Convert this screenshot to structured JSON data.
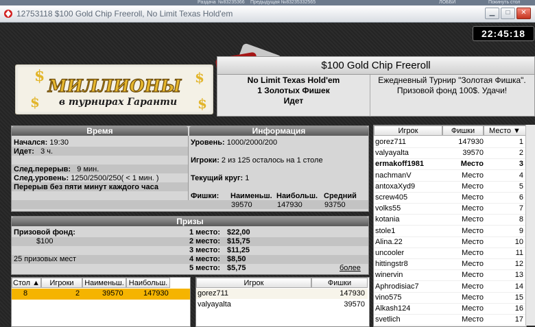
{
  "taskbar": {
    "items": [
      "Раздача",
      "№83235366",
      "Предыдущая №83235332565",
      "ЛОББИ",
      "Покинуть стол"
    ]
  },
  "window": {
    "title": "12753118 $100 Gold Chip Freeroll, No Limit Texas Hold'em",
    "clock": "22:45:18"
  },
  "logo": {
    "text": "МИЛЛИОНЫ",
    "subtext": "в турнирах Гаранти"
  },
  "tournament": {
    "name": "$100 Gold Chip Freeroll",
    "game": "No Limit Texas Hold'em",
    "chips_type": "1 Золотых Фишек",
    "status": "Идет",
    "description": "Ежедневный Турнир \"Золотая Фишка\". Призовой фонд 100$. Удачи!"
  },
  "time_panel": {
    "header_time": "Время",
    "header_info": "Информация",
    "started_label": "Начался:",
    "started_value": "19:30",
    "running_label": "Идет:",
    "running_value": "3 ч.",
    "next_break_label": "След.перерыв:",
    "next_break_value": "9 мин.",
    "next_level_label": "След.уровень:",
    "next_level_value": "1250/2500/250( < 1 мин. )",
    "break_note": "Перерыв без пяти минут каждого часа",
    "level_label": "Уровень:",
    "level_value": "1000/2000/200",
    "players_label": "Игроки:",
    "players_value": "2 из 125 осталось на 1 столе",
    "round_label": "Текущий круг:",
    "round_value": "1",
    "chips_label": "Фишки:",
    "chips_min_label": "Наименьш.",
    "chips_max_label": "Наибольш.",
    "chips_avg_label": "Средний",
    "chips_min": "39570",
    "chips_max": "147930",
    "chips_avg": "93750"
  },
  "prizes": {
    "header": "Призы",
    "pool_label": "Призовой фонд:",
    "pool_value": "$100",
    "paid_places": "25 призовых мест",
    "places": [
      {
        "label": "1 место:",
        "value": "$22,00"
      },
      {
        "label": "2 место:",
        "value": "$15,75"
      },
      {
        "label": "3 место:",
        "value": "$11,25"
      },
      {
        "label": "4 место:",
        "value": "$8,50"
      },
      {
        "label": "5 место:",
        "value": "$5,75"
      }
    ],
    "more_link": "более"
  },
  "tables": {
    "headers": [
      "Стол",
      "Игроки",
      "Наименьш.",
      "Наибольш."
    ],
    "rows": [
      {
        "table": "8",
        "players": "2",
        "min": "39570",
        "max": "147930"
      }
    ]
  },
  "table_players": {
    "headers": [
      "Игрок",
      "Фишки"
    ],
    "rows": [
      {
        "name": "gorez711",
        "chips": "147930"
      },
      {
        "name": "valyayalta",
        "chips": "39570"
      }
    ]
  },
  "standings": {
    "headers": [
      "Игрок",
      "Фишки",
      "Место"
    ],
    "rows": [
      {
        "name": "gorez711",
        "chips": "147930",
        "place": "1",
        "bold": false
      },
      {
        "name": "valyayalta",
        "chips": "39570",
        "place": "2",
        "bold": false
      },
      {
        "name": "ermakoff1981",
        "chips": "Место",
        "place": "3",
        "bold": true
      },
      {
        "name": "nachmanV",
        "chips": "Место",
        "place": "4",
        "bold": false
      },
      {
        "name": "antoxaXyd9",
        "chips": "Место",
        "place": "5",
        "bold": false
      },
      {
        "name": "screw405",
        "chips": "Место",
        "place": "6",
        "bold": false
      },
      {
        "name": "volks55",
        "chips": "Место",
        "place": "7",
        "bold": false
      },
      {
        "name": "kotania",
        "chips": "Место",
        "place": "8",
        "bold": false
      },
      {
        "name": "stole1",
        "chips": "Место",
        "place": "9",
        "bold": false
      },
      {
        "name": "Alina.22",
        "chips": "Место",
        "place": "10",
        "bold": false
      },
      {
        "name": "uncooler",
        "chips": "Место",
        "place": "11",
        "bold": false
      },
      {
        "name": "hittingstr8",
        "chips": "Место",
        "place": "12",
        "bold": false
      },
      {
        "name": "winervin",
        "chips": "Место",
        "place": "13",
        "bold": false
      },
      {
        "name": "Aphrodisiac7",
        "chips": "Место",
        "place": "14",
        "bold": false
      },
      {
        "name": "vino575",
        "chips": "Место",
        "place": "15",
        "bold": false
      },
      {
        "name": "Alkash124",
        "chips": "Место",
        "place": "16",
        "bold": false
      },
      {
        "name": "svetlich",
        "chips": "Место",
        "place": "17",
        "bold": false
      }
    ]
  }
}
